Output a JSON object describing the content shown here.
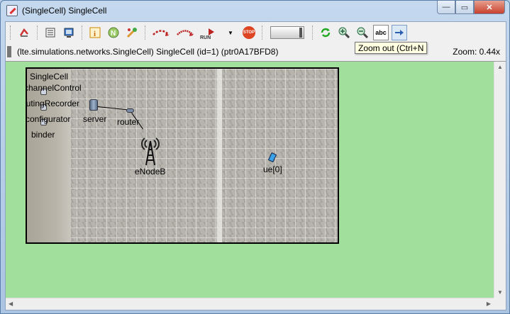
{
  "window": {
    "title": "(SingleCell) SingleCell",
    "buttons": {
      "minimize": "—",
      "maximize": "▭",
      "close": "✕"
    }
  },
  "toolbar": {
    "items": [
      {
        "name": "redraw-icon",
        "glyph": "↺"
      },
      {
        "name": "object-list-icon",
        "glyph": "☰"
      },
      {
        "name": "inspector-icon",
        "glyph": "▣"
      },
      {
        "name": "info-icon",
        "glyph": "i"
      },
      {
        "name": "network-icon",
        "glyph": "N"
      },
      {
        "name": "tools-icon",
        "glyph": "✎"
      },
      {
        "name": "step-icon",
        "glyph": "↷"
      },
      {
        "name": "fast-icon",
        "glyph": "⇒"
      },
      {
        "name": "run-icon",
        "glyph": "▶"
      },
      {
        "name": "stop-icon",
        "glyph": "STOP"
      },
      {
        "name": "refresh-icon",
        "glyph": "⟳"
      },
      {
        "name": "zoom-in-icon",
        "glyph": "⊕"
      },
      {
        "name": "zoom-out-icon",
        "glyph": "⊖"
      },
      {
        "name": "show-labels-icon",
        "glyph": "abc"
      },
      {
        "name": "arrow-icon",
        "glyph": "➜"
      }
    ],
    "run_label": "RUN",
    "stop_label": "STOP",
    "labels_glyph": "abc"
  },
  "tooltip": "Zoom out (Ctrl+N",
  "status": {
    "path": "(lte.simulations.networks.SingleCell) SingleCell  (id=1)  (ptr0A17BFD8)",
    "zoom": "Zoom: 0.44x"
  },
  "network": {
    "title": "SingleCell",
    "modules": [
      "channelControl",
      "routingRecorder",
      "configurator",
      "binder"
    ],
    "server": "server",
    "router": "router",
    "enodeb": "eNodeB",
    "ue": "ue[0]"
  },
  "colors": {
    "canvas": "#a1e09c",
    "ue": "#3aa0e8",
    "stop": "#dd4422"
  }
}
